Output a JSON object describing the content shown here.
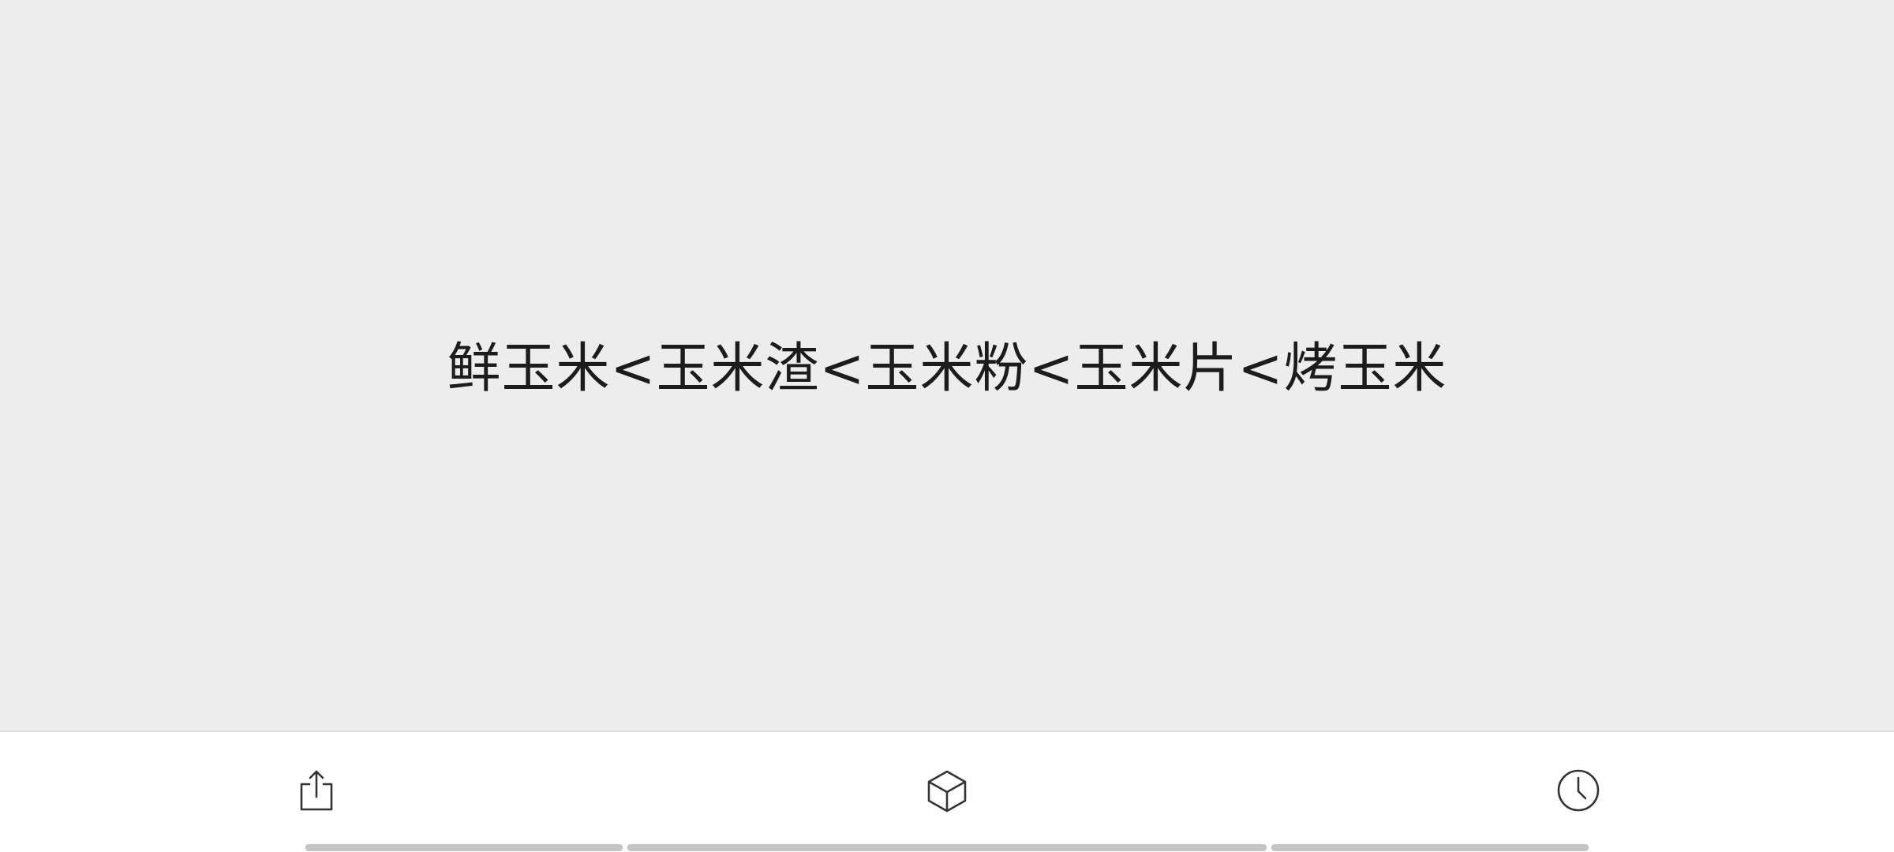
{
  "viewer": {
    "text": "鲜玉米<玉米渣<玉米粉<玉米片<烤玉米"
  },
  "toolbar": {
    "items": [
      {
        "icon": "share-icon"
      },
      {
        "icon": "cube-icon"
      },
      {
        "icon": "clock-icon"
      }
    ]
  },
  "progress": {
    "segments": 3
  },
  "colors": {
    "viewer_bg": "#ededed",
    "text": "#1c1c1c",
    "toolbar_bg": "#ffffff",
    "icon": "#333333",
    "progress_track": "#c4c4c4"
  }
}
